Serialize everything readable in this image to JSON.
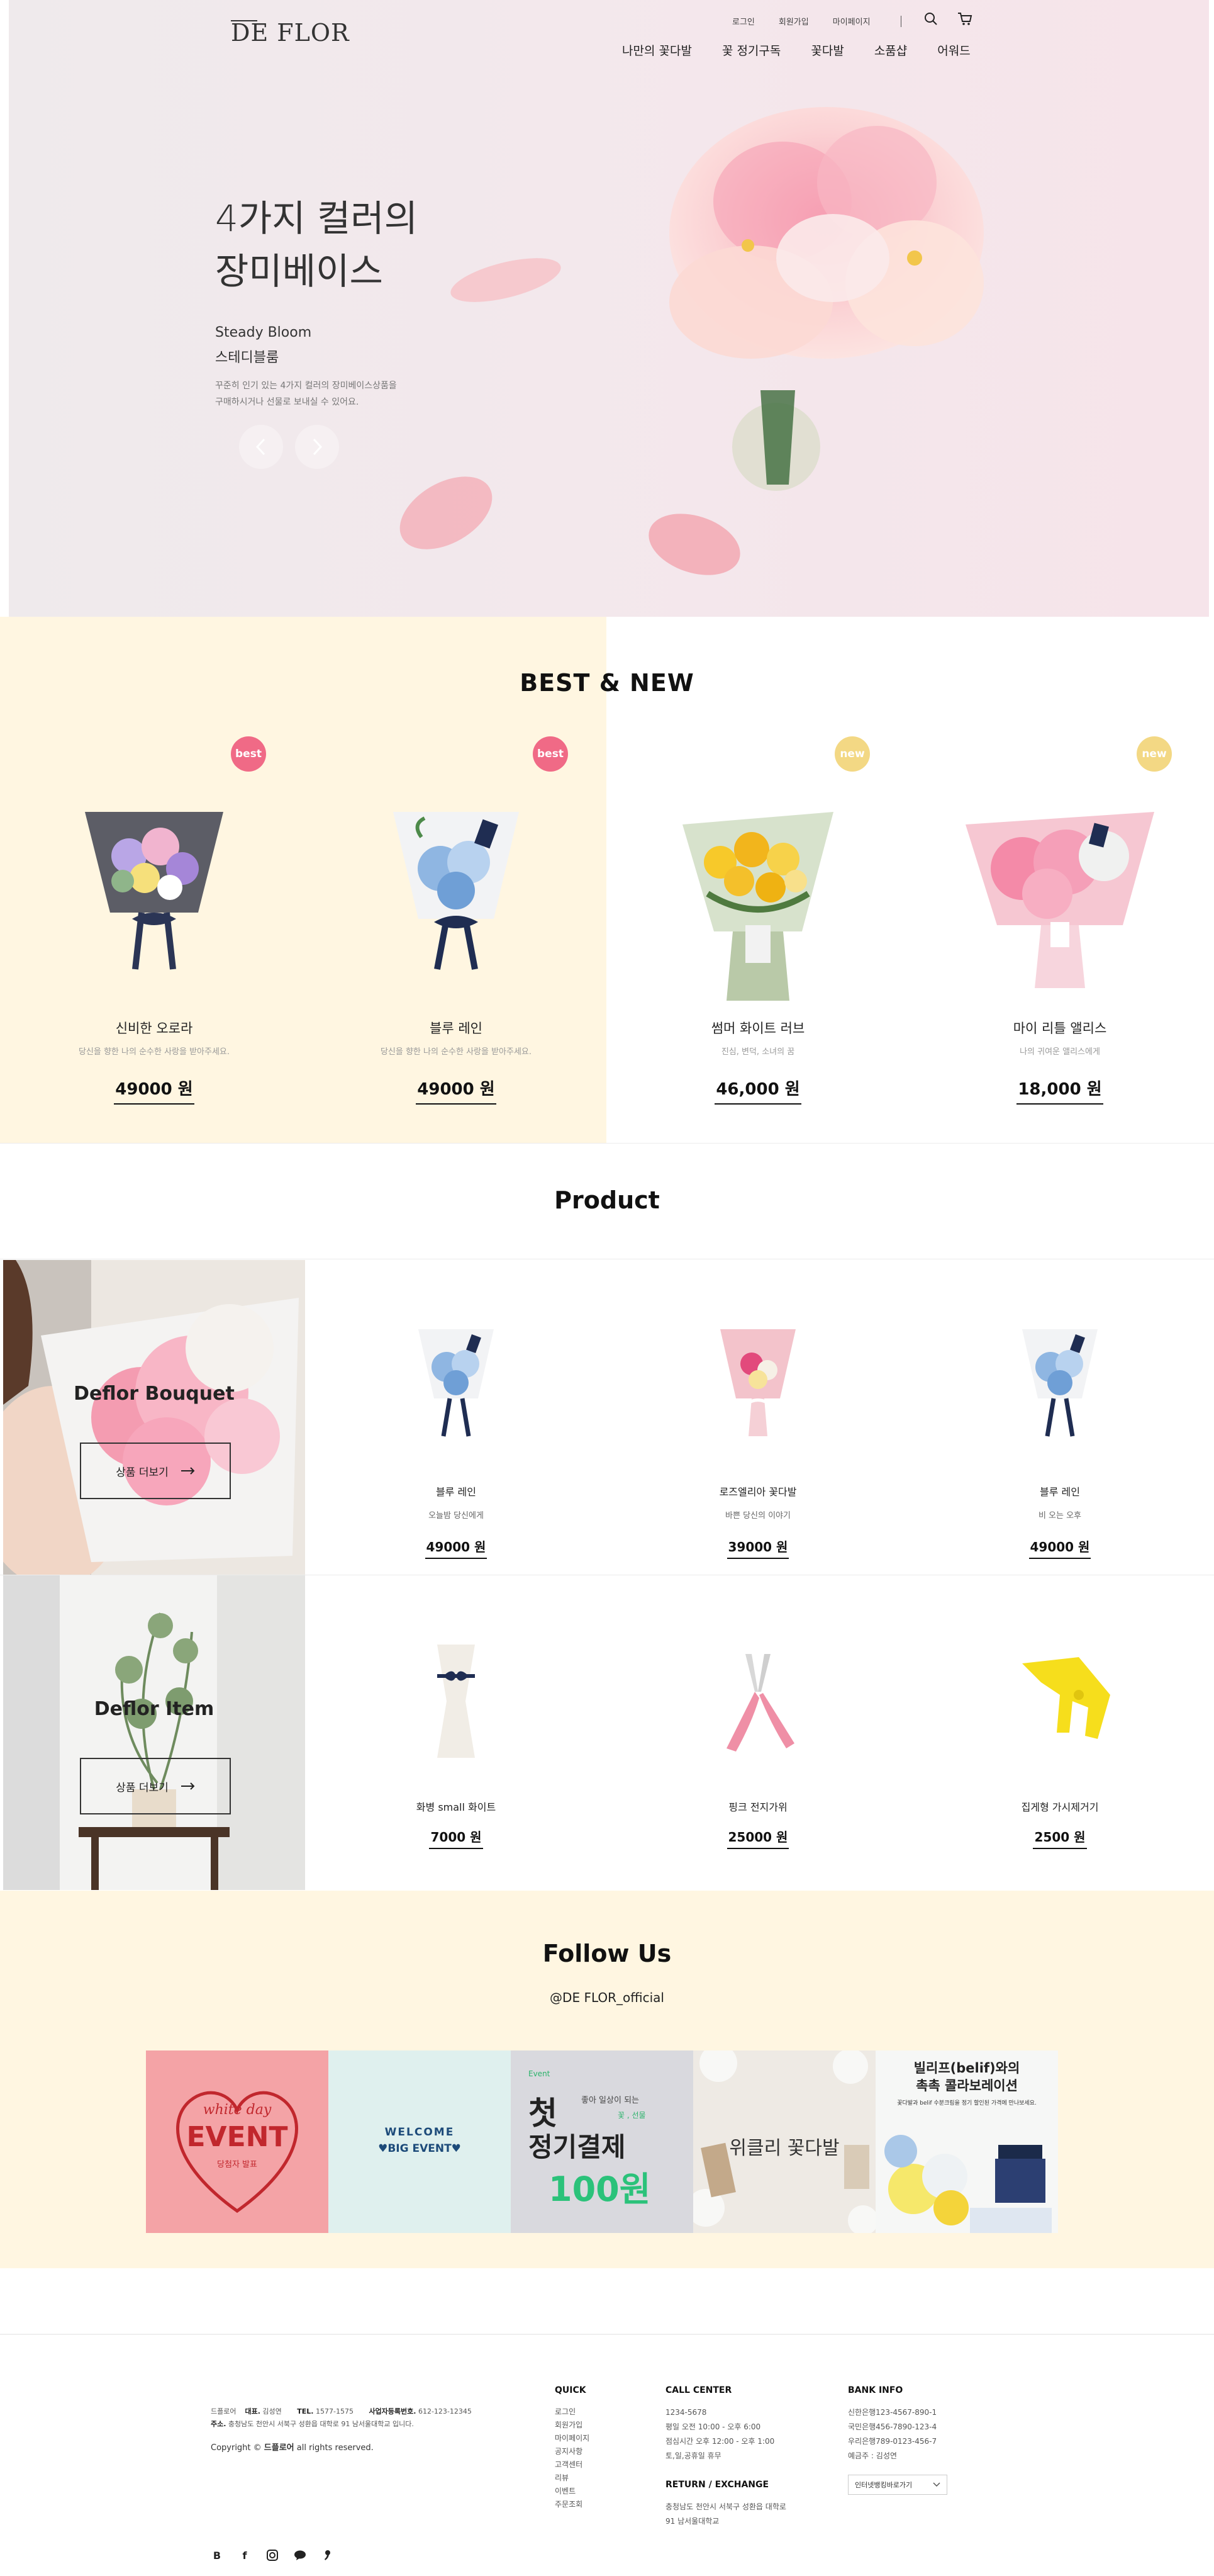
{
  "header": {
    "logo": "DE FLOR",
    "util_links": [
      "로그인",
      "회원가입",
      "마이페이지"
    ],
    "nav": [
      "나만의 꽃다발",
      "꽃 정기구독",
      "꽃다발",
      "소품샵",
      "어워드"
    ]
  },
  "hero": {
    "title_line1": "4가지 컬러의",
    "title_line2": "장미베이스",
    "sub_en": "Steady Bloom",
    "sub_ko": "스테디블룸",
    "desc_line1": "꾸준히 인기 있는 4가지 컬러의 장미베이스상품을",
    "desc_line2": "구매하시거나 선물로 보내실 수 있어요."
  },
  "best_new": {
    "title": "BEST & NEW",
    "items": [
      {
        "badge": "best",
        "name": "신비한 오로라",
        "desc": "당신을 향한 나의 순수한 사랑을 받아주세요.",
        "price": "49000 원"
      },
      {
        "badge": "best",
        "name": "블루 레인",
        "desc": "당신을 향한 나의 순수한 사랑을 받아주세요.",
        "price": "49000 원"
      },
      {
        "badge": "new",
        "name": "썸머 화이트 러브",
        "desc": "진심, 변덕, 소녀의 꿈",
        "price": "46,000 원"
      },
      {
        "badge": "new",
        "name": "마이 리틀 앨리스",
        "desc": "나의 귀여운 앨리스에게",
        "price": "18,000 원"
      }
    ]
  },
  "product": {
    "title": "Product",
    "promos": [
      {
        "title": "Deflor Bouquet",
        "button": "상품 더보기"
      },
      {
        "title": "Deflor Item",
        "button": "상품 더보기"
      }
    ],
    "row1": [
      {
        "name": "블루 레인",
        "desc": "오늘밤 당신에게",
        "price": "49000 원"
      },
      {
        "name": "로즈엘리아 꽃다발",
        "desc": "바쁜 당신의 이야기",
        "price": "39000 원"
      },
      {
        "name": "블루 레인",
        "desc": "비 오는 오후",
        "price": "49000 원"
      }
    ],
    "row2": [
      {
        "name": "화병 small 화이트",
        "price": "7000 원"
      },
      {
        "name": "핑크 전지가위",
        "price": "25000 원"
      },
      {
        "name": "집게형 가시제거기",
        "price": "2500 원"
      }
    ]
  },
  "follow": {
    "title": "Follow Us",
    "handle": "@DE FLOR_official",
    "posts": {
      "event_script": "white day",
      "event_big": "EVENT",
      "event_small": "당첨자 발표",
      "welcome_line1": "WELCOME",
      "welcome_line2": "♥BIG EVENT♥",
      "sub_tag": "Event",
      "sub_small1": "좋아 일상이 되는",
      "sub_small2": "꽃 , 선물",
      "sub_big1": "첫",
      "sub_big2": "정기결제",
      "sub_big3": "100원",
      "weekly": "위클리 꽃다발",
      "belif_line1": "빌리프(belif)와의",
      "belif_line2": "촉촉 콜라보레이션",
      "belif_small": "꽃다발과 belif 수분크림을 정기 할인된 가격에 만나보세요."
    }
  },
  "footer": {
    "company": "드플로어",
    "ceo_label": "대표.",
    "ceo": "김성연",
    "tel_label": "TEL.",
    "tel": "1577-1575",
    "biz_label": "사업자등록번호.",
    "biz": "612-123-12345",
    "addr_label": "주소.",
    "addr": "충청남도 천안시 서북구 성환읍 대학로 91 남서울대학교 입니다.",
    "copyright_pre": "Copyright ©",
    "copyright_brand": "드플로어",
    "copyright_post": "all rights reserved.",
    "quick_title": "QUICK",
    "quick": [
      "로그인",
      "회원가입",
      "마이페이지",
      "공지사항",
      "고객센터",
      "리뷰",
      "이벤트",
      "주문조회"
    ],
    "cc_title": "CALL CENTER",
    "cc": [
      "1234-5678",
      "평일 오전 10:00 - 오후 6:00",
      "점심시간 오후 12:00 - 오후 1:00",
      "토,일,공휴일 휴무"
    ],
    "return_title": "RETURN / EXCHANGE",
    "return": [
      "충청남도 천안시 서북구 성환읍 대학로",
      "91 남서울대학교"
    ],
    "bank_title": "BANK INFO",
    "bank": [
      "신한은행123-4567-890-1",
      "국민은행456-7890-123-4",
      "우리은행789-0123-456-7",
      "예금주 : 김성연"
    ],
    "bank_select": "인터넷뱅킹바로가기"
  },
  "colors": {
    "pale_yellow": "#fff6e1",
    "best_badge": "#f06a86",
    "new_badge": "#f3d884"
  }
}
